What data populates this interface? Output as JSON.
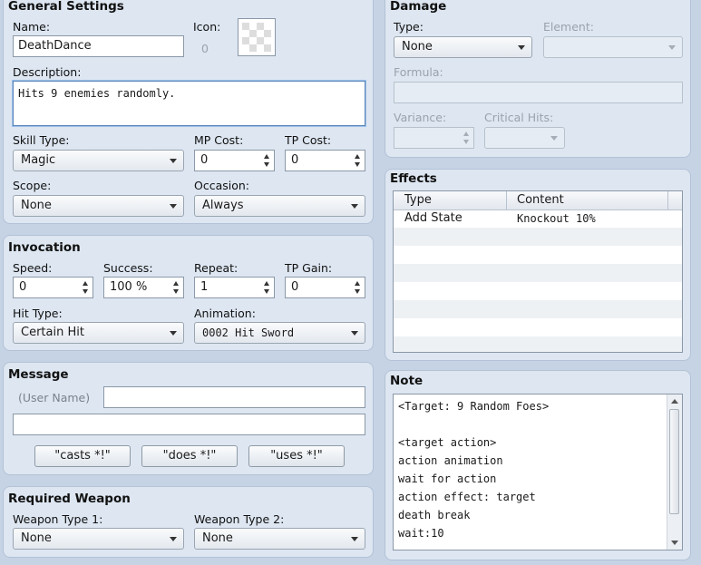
{
  "general": {
    "title": "General Settings",
    "name_label": "Name:",
    "name_value": "DeathDance",
    "icon_label": "Icon:",
    "icon_index": "0",
    "description_label": "Description:",
    "description_value": "Hits 9 enemies randomly.",
    "skill_type_label": "Skill Type:",
    "skill_type_value": "Magic",
    "mp_cost_label": "MP Cost:",
    "mp_cost_value": "0",
    "tp_cost_label": "TP Cost:",
    "tp_cost_value": "0",
    "scope_label": "Scope:",
    "scope_value": "None",
    "occasion_label": "Occasion:",
    "occasion_value": "Always"
  },
  "invocation": {
    "title": "Invocation",
    "speed_label": "Speed:",
    "speed_value": "0",
    "success_label": "Success:",
    "success_value": "100 %",
    "repeat_label": "Repeat:",
    "repeat_value": "1",
    "tp_gain_label": "TP Gain:",
    "tp_gain_value": "0",
    "hit_type_label": "Hit Type:",
    "hit_type_value": "Certain Hit",
    "animation_label": "Animation:",
    "animation_value": "0002 Hit Sword"
  },
  "message": {
    "title": "Message",
    "user_name_label": "(User Name)",
    "line1_value": "",
    "line2_value": "",
    "buttons": [
      "\"casts *!\"",
      "\"does *!\"",
      "\"uses *!\""
    ]
  },
  "required_weapon": {
    "title": "Required Weapon",
    "weapon_type1_label": "Weapon Type 1:",
    "weapon_type1_value": "None",
    "weapon_type2_label": "Weapon Type 2:",
    "weapon_type2_value": "None"
  },
  "damage": {
    "title": "Damage",
    "type_label": "Type:",
    "type_value": "None",
    "element_label": "Element:",
    "element_value": "",
    "formula_label": "Formula:",
    "formula_value": "",
    "variance_label": "Variance:",
    "variance_value": "",
    "critical_label": "Critical Hits:",
    "critical_value": ""
  },
  "effects": {
    "title": "Effects",
    "columns": [
      "Type",
      "Content"
    ],
    "rows": [
      {
        "type": "Add State",
        "content": "Knockout 10%"
      }
    ]
  },
  "note": {
    "title": "Note",
    "lines": [
      "<Target: 9 Random Foes>",
      "",
      "<target action>",
      "action animation",
      "wait for action",
      "action effect: target",
      "death break",
      "wait:10"
    ]
  },
  "colors": {
    "background": "#c5d3e4",
    "panel": "#dde6f1",
    "disabled_text": "#9aa3ad"
  }
}
